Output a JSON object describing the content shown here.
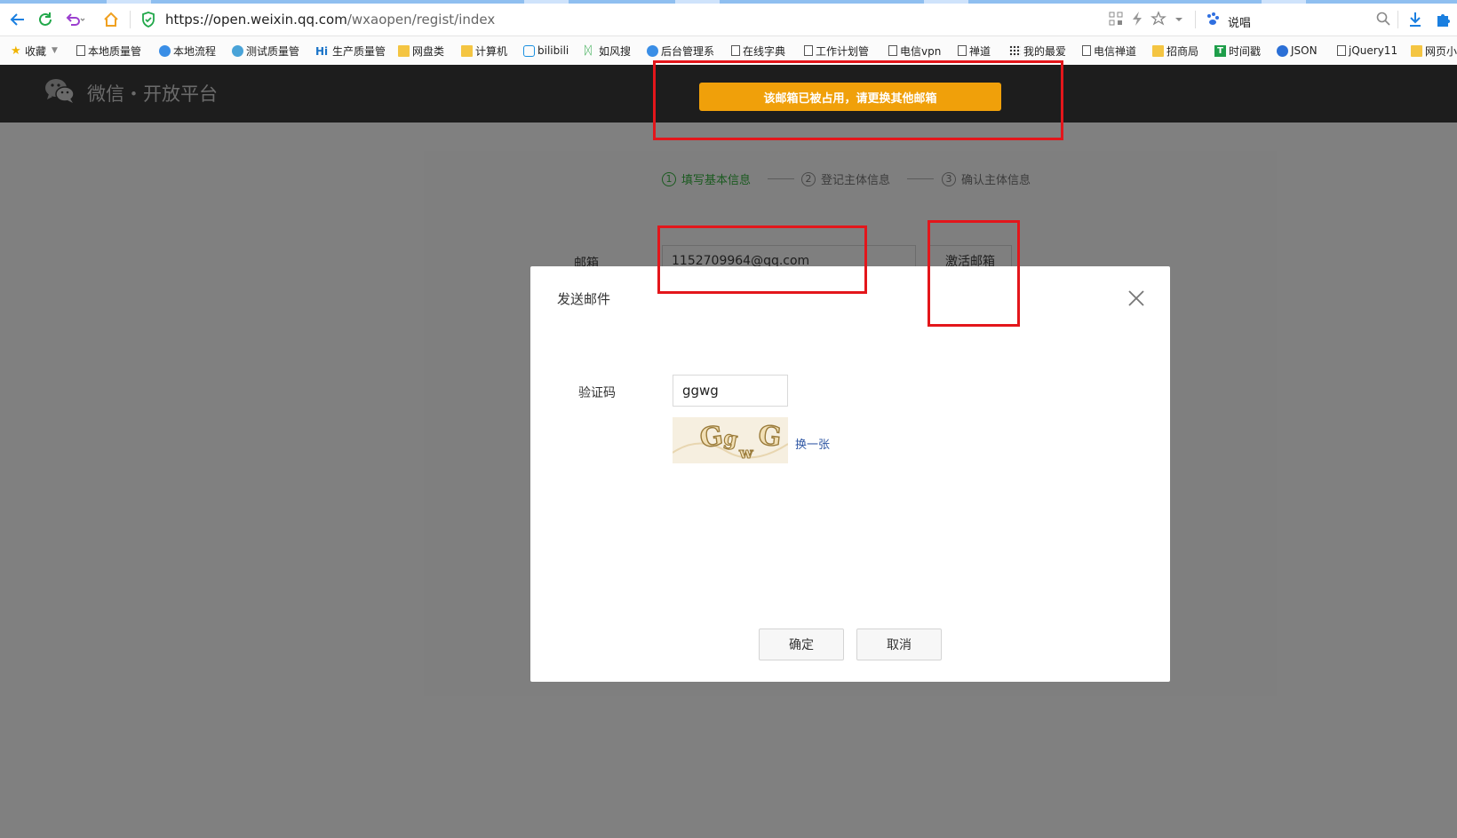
{
  "browser": {
    "url_host": "https://open.weixin.qq.com",
    "url_path": "/wxaopen/regist/index",
    "search_text": "说唱"
  },
  "bookmarks": [
    {
      "label": "收藏",
      "icon": "star-icon"
    },
    {
      "label": "本地质量管",
      "icon": "doc-icon"
    },
    {
      "label": "本地流程",
      "icon": "globe-icon"
    },
    {
      "label": "测试质量管",
      "icon": "globe-icon"
    },
    {
      "label": "生产质量管",
      "icon": "hi-icon"
    },
    {
      "label": "网盘类",
      "icon": "folder-icon"
    },
    {
      "label": "计算机",
      "icon": "folder-icon"
    },
    {
      "label": "bilibili",
      "icon": "bilibili-icon"
    },
    {
      "label": "如风搜",
      "icon": "leaf-icon"
    },
    {
      "label": "后台管理系",
      "icon": "globe-icon"
    },
    {
      "label": "在线字典",
      "icon": "doc-icon"
    },
    {
      "label": "工作计划管",
      "icon": "doc-icon"
    },
    {
      "label": "电信vpn",
      "icon": "doc-icon"
    },
    {
      "label": "禅道",
      "icon": "doc-icon"
    },
    {
      "label": "我的最爱",
      "icon": "grid-icon"
    },
    {
      "label": "电信禅道",
      "icon": "doc-icon"
    },
    {
      "label": "招商局",
      "icon": "folder-icon"
    },
    {
      "label": "时间戳",
      "icon": "timestamp-icon"
    },
    {
      "label": "JSON",
      "icon": "globe-icon"
    },
    {
      "label": "jQuery11",
      "icon": "doc-icon"
    },
    {
      "label": "网页小",
      "icon": "folder-icon"
    }
  ],
  "header": {
    "logo_text": "微信・开放平台",
    "toast": "该邮箱已被占用，请更换其他邮箱"
  },
  "steps": [
    {
      "num": "1",
      "label": "填写基本信息"
    },
    {
      "num": "2",
      "label": "登记主体信息"
    },
    {
      "num": "3",
      "label": "确认主体信息"
    }
  ],
  "form": {
    "email_label": "邮箱",
    "email_value": "1152709964@qq.com",
    "activate_label": "激活邮箱"
  },
  "modal": {
    "title": "发送邮件",
    "captcha_label": "验证码",
    "captcha_value": "ggwg",
    "captcha_image_text": "GgwG",
    "refresh_label": "换一张",
    "ok_label": "确定",
    "cancel_label": "取消"
  },
  "colors": {
    "toast_bg": "#f0a00a",
    "annotation_red": "#e3161b",
    "active_step": "#1aad19",
    "link": "#2f57a4"
  }
}
